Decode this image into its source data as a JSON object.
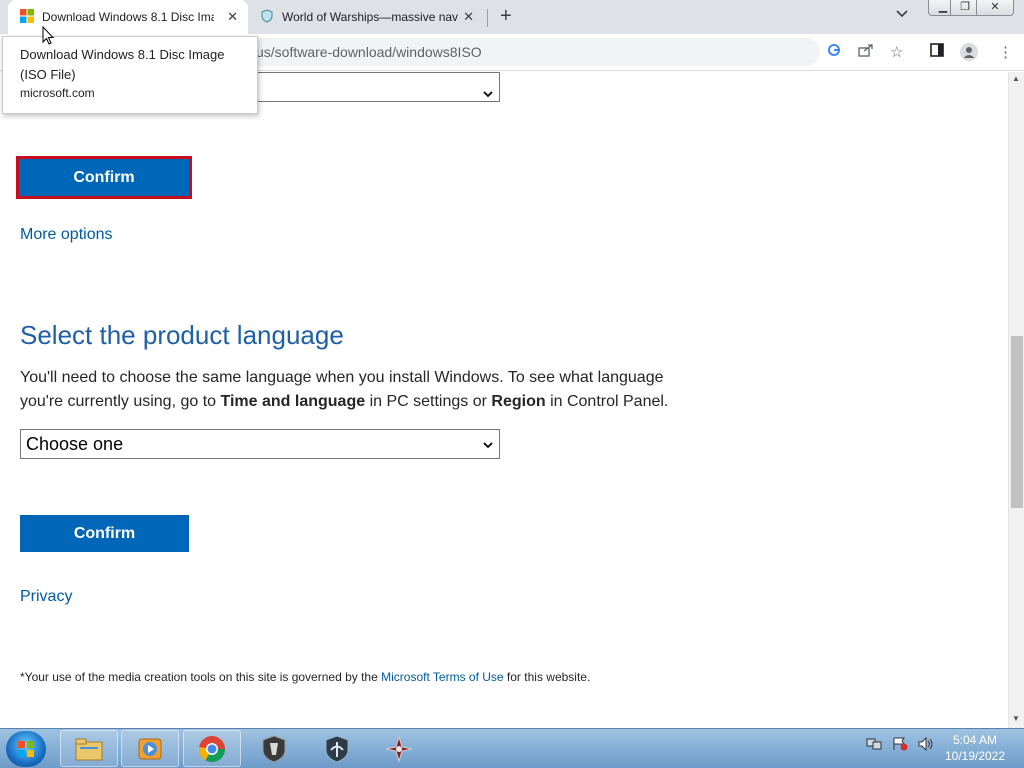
{
  "browser": {
    "tabs": [
      {
        "title": "Download Windows 8.1 Disc Ima",
        "active": true
      },
      {
        "title": "World of Warships—massive nav",
        "active": false
      }
    ],
    "url": "us/software-download/windows8ISO",
    "tooltip": {
      "title": "Download Windows 8.1 Disc Image (ISO File)",
      "domain": "microsoft.com"
    }
  },
  "page": {
    "top_confirm_label": "Confirm",
    "more_options": "More options",
    "language_heading": "Select the product language",
    "language_text_1": "You'll need to choose the same language when you install Windows. To see what language you're currently using, go to ",
    "language_bold_1": "Time and language",
    "language_text_2": " in PC settings or ",
    "language_bold_2": "Region",
    "language_text_3": " in Control Panel.",
    "language_select_value": "Choose one",
    "bottom_confirm_label": "Confirm",
    "privacy": "Privacy",
    "footnote_prefix": "*Your use of the media creation tools on this site is governed by the ",
    "footnote_link": "Microsoft Terms of Use",
    "footnote_suffix": " for this website."
  },
  "taskbar": {
    "time": "5:04 AM",
    "date": "10/19/2022"
  },
  "colors": {
    "accent": "#0067b8",
    "focus_ring": "#c50f1f",
    "link": "#005a9e"
  }
}
